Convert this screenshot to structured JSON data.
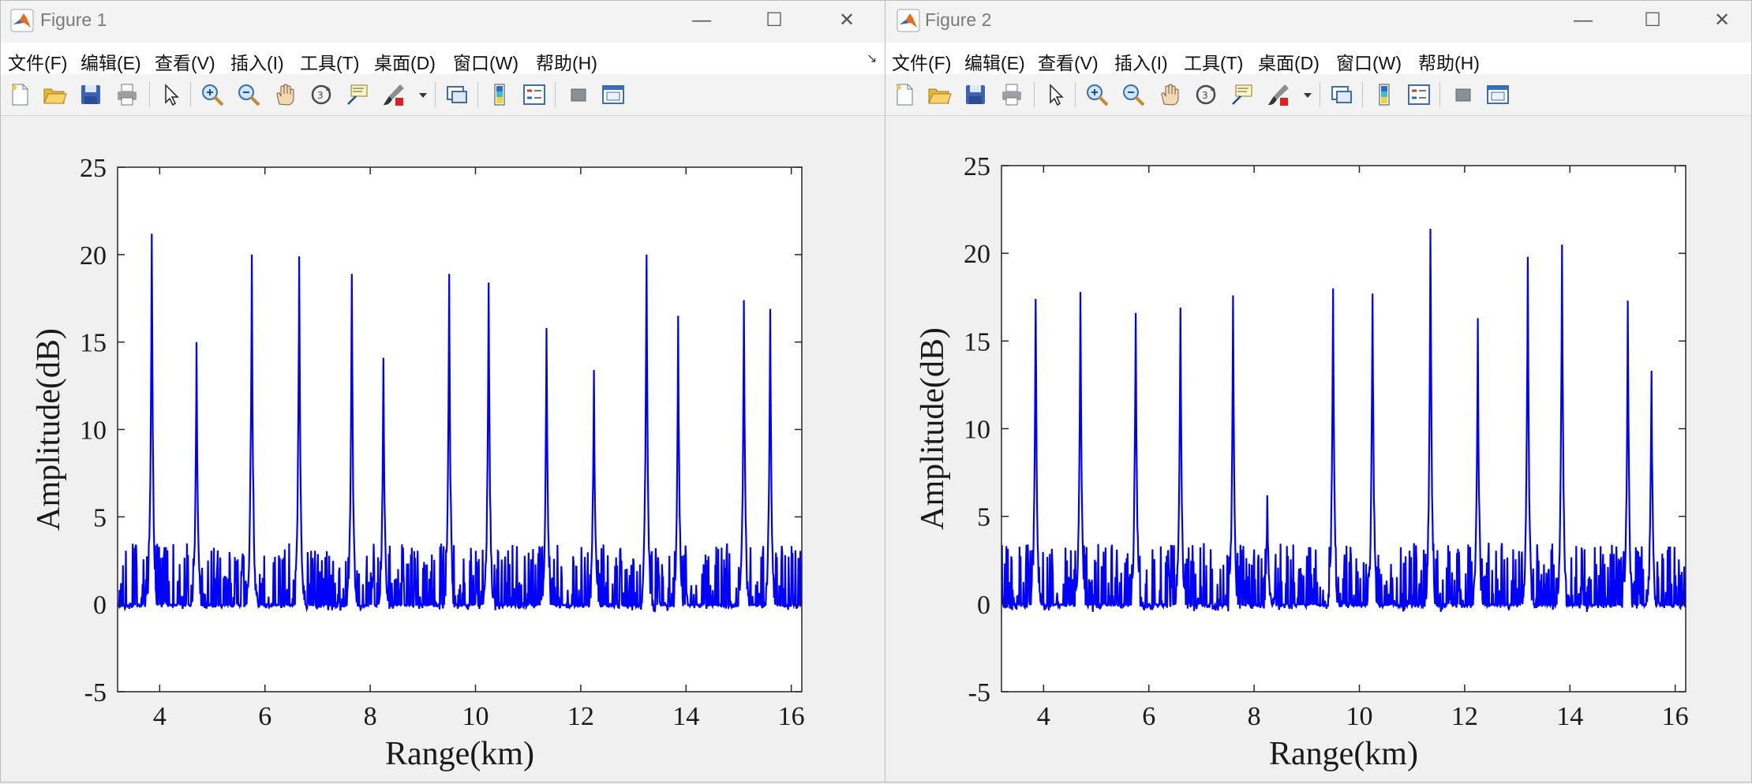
{
  "colors": {
    "line": "#0000ff",
    "axes_bg": "#ffffff",
    "window_bg": "#f0f0f0"
  },
  "windows": [
    {
      "title": "Figure 1",
      "menus": [
        "文件(F)",
        "编辑(E)",
        "查看(V)",
        "插入(I)",
        "工具(T)",
        "桌面(D)",
        "窗口(W)",
        "帮助(H)"
      ],
      "controls": {
        "minimize": "—",
        "maximize": "☐",
        "close": "✕"
      },
      "toolbar_icons": [
        "new-figure-icon",
        "open-file-icon",
        "save-icon",
        "print-icon",
        "edit-plot-cursor-icon",
        "zoom-in-icon",
        "zoom-out-icon",
        "pan-hand-icon",
        "rotate-3d-icon",
        "data-cursor-icon",
        "brush-icon",
        "brush-dropdown-arrow-icon",
        "link-plot-icon",
        "insert-colorbar-icon",
        "insert-legend-icon",
        "hide-plot-tools-icon",
        "show-plot-tools-icon"
      ]
    },
    {
      "title": "Figure 2",
      "menus": [
        "文件(F)",
        "编辑(E)",
        "查看(V)",
        "插入(I)",
        "工具(T)",
        "桌面(D)",
        "窗口(W)",
        "帮助(H)"
      ],
      "controls": {
        "minimize": "—",
        "maximize": "☐",
        "close": "✕"
      },
      "toolbar_icons": [
        "new-figure-icon",
        "open-file-icon",
        "save-icon",
        "print-icon",
        "edit-plot-cursor-icon",
        "zoom-in-icon",
        "zoom-out-icon",
        "pan-hand-icon",
        "rotate-3d-icon",
        "data-cursor-icon",
        "brush-icon",
        "brush-dropdown-arrow-icon",
        "link-plot-icon",
        "insert-colorbar-icon",
        "insert-legend-icon",
        "hide-plot-tools-icon",
        "show-plot-tools-icon"
      ]
    }
  ],
  "chart_data": [
    {
      "type": "line",
      "xlabel": "Range(km)",
      "ylabel": "Amplitude(dB)",
      "xlim": [
        3.2,
        16.2
      ],
      "ylim": [
        -5,
        25
      ],
      "xticks": [
        4,
        6,
        8,
        10,
        12,
        14,
        16
      ],
      "yticks": [
        -5,
        0,
        5,
        10,
        15,
        20,
        25
      ],
      "noise_floor_range_db": [
        -5,
        5
      ],
      "series": [
        {
          "peaks": [
            {
              "x": 3.85,
              "y": 21.2
            },
            {
              "x": 4.7,
              "y": 15.0
            },
            {
              "x": 5.75,
              "y": 20.0
            },
            {
              "x": 6.65,
              "y": 19.9
            },
            {
              "x": 7.65,
              "y": 18.9
            },
            {
              "x": 8.25,
              "y": 14.1
            },
            {
              "x": 9.5,
              "y": 18.9
            },
            {
              "x": 10.25,
              "y": 18.4
            },
            {
              "x": 11.35,
              "y": 15.8
            },
            {
              "x": 12.25,
              "y": 13.4
            },
            {
              "x": 13.25,
              "y": 20.0
            },
            {
              "x": 13.85,
              "y": 16.5
            },
            {
              "x": 15.1,
              "y": 17.4
            },
            {
              "x": 15.6,
              "y": 16.9
            }
          ]
        }
      ]
    },
    {
      "type": "line",
      "xlabel": "Range(km)",
      "ylabel": "Amplitude(dB)",
      "xlim": [
        3.2,
        16.2
      ],
      "ylim": [
        -5,
        25
      ],
      "xticks": [
        4,
        6,
        8,
        10,
        12,
        14,
        16
      ],
      "yticks": [
        -5,
        0,
        5,
        10,
        15,
        20,
        25
      ],
      "noise_floor_range_db": [
        -5,
        5
      ],
      "series": [
        {
          "peaks": [
            {
              "x": 3.85,
              "y": 17.4
            },
            {
              "x": 4.7,
              "y": 17.8
            },
            {
              "x": 5.75,
              "y": 16.6
            },
            {
              "x": 6.6,
              "y": 16.9
            },
            {
              "x": 7.6,
              "y": 17.6
            },
            {
              "x": 8.25,
              "y": 6.2
            },
            {
              "x": 9.5,
              "y": 18.0
            },
            {
              "x": 10.25,
              "y": 17.7
            },
            {
              "x": 11.35,
              "y": 21.4
            },
            {
              "x": 12.25,
              "y": 16.3
            },
            {
              "x": 13.2,
              "y": 19.8
            },
            {
              "x": 13.85,
              "y": 20.5
            },
            {
              "x": 15.1,
              "y": 17.3
            },
            {
              "x": 15.55,
              "y": 13.3
            }
          ]
        }
      ]
    }
  ]
}
